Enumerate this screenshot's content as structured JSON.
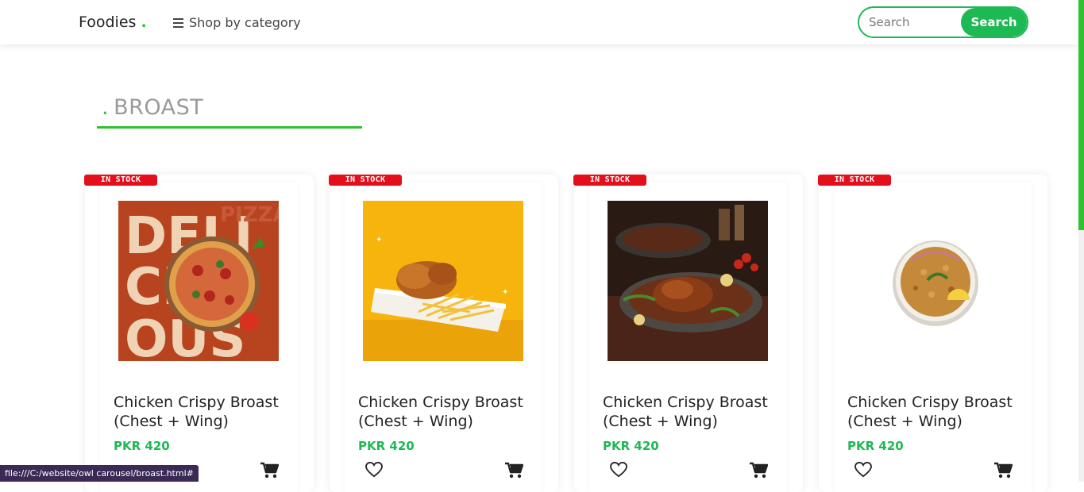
{
  "nav": {
    "brand": "Foodies",
    "brand_dot": ".",
    "shop_by_category": "Shop by category",
    "search_placeholder": "Search",
    "search_button": "Search"
  },
  "section": {
    "dot": ".",
    "title": "BROAST"
  },
  "products": [
    {
      "badge": "IN STOCK",
      "title": "Chicken Crispy Broast (Chest + Wing)",
      "price": "PKR 420",
      "image": "pizza-poster"
    },
    {
      "badge": "IN STOCK",
      "title": "Chicken Crispy Broast (Chest + Wing)",
      "price": "PKR 420",
      "image": "fried-chicken-fries"
    },
    {
      "badge": "IN STOCK",
      "title": "Chicken Crispy Broast (Chest + Wing)",
      "price": "PKR 420",
      "image": "roast-chicken-platter"
    },
    {
      "badge": "IN STOCK",
      "title": "Chicken Crispy Broast (Chest + Wing)",
      "price": "PKR 420",
      "image": "biryani-bowl"
    }
  ],
  "pizza_poster_text": {
    "line1": "DELI",
    "line2": "CI",
    "line3": "OUS",
    "side": "PIZZA"
  },
  "status_bar": "file:///C:/website/owl carousel/broast.html#",
  "colors": {
    "accent": "#2ec22e",
    "button": "#1db954",
    "badge": "#e3101b"
  }
}
